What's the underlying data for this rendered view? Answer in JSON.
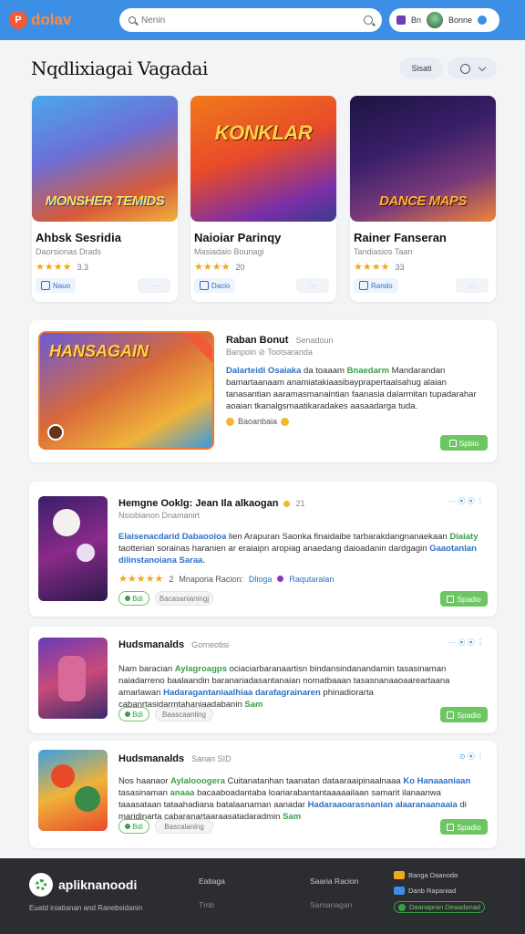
{
  "header": {
    "logo_badge": "P",
    "logo_text": "dolav",
    "search_placeholder": "Nenin",
    "user_label": "Bn",
    "user_name": "Bonne"
  },
  "page": {
    "title": "Nqdlixiagai Vagadai",
    "filter_label": "Sisati"
  },
  "featured": [
    {
      "art_title": "MONSHER TEMIDS",
      "title": "Ahbsk Sesridia",
      "subtitle": "Daorsionas Drads",
      "stars": "★★★★",
      "rating": "3.3",
      "button": "Nauo",
      "dots": "···"
    },
    {
      "art_title": "KONKLAR",
      "title": "Naioiar Parinqy",
      "subtitle": "Masiadaio Bounagi",
      "stars": "★★★★",
      "rating": "20",
      "button": "Dacio",
      "dots": "···"
    },
    {
      "art_title": "DANCE MAPS",
      "title": "Rainer Fanseran",
      "subtitle": "Tandiasios Taan",
      "stars": "★★★★",
      "rating": "33",
      "button": "Rando",
      "dots": "···"
    }
  ],
  "promo": {
    "art_title": "HANSAGAIN",
    "title": "Raban Bonut",
    "title_meta": "Senadoun",
    "meta": "Banpoin  ⊘  Tootsaranda",
    "desc_blue": "Dalarteidi Osaiaka",
    "desc_mid": " da toaaam ",
    "desc_green": "Bnaedarm",
    "desc_rest": " Mandarandan bamartaanaam anamiatakiaasibayprapertaalsahug alaian tanasantian aaramasmanaintian faanasia dalarmitan tupadarahar aoaian tkanalgsmaatikaradakes aasaadarga tuda.",
    "emoji_text": "Baoanbaia",
    "button": "Spbio"
  },
  "list": [
    {
      "title": "Hemgne Ooklg: Jean Ila alkaogan",
      "title_count": "21",
      "meta": "Nsiobianon Dnamanirt",
      "desc_blue": "Elaisenacdarid Dabaooioa",
      "desc_mid": " lien Arapuran Saonka finaidaibe tarbarakdangnanaekaan ",
      "desc_green": "Diaiaty",
      "desc_rest": " taotterian sorainas haranien ar eraiaipn aropiag anaedang daioadanin dardgagin",
      "desc_blue2": "Gaaotanlan dilinstanoiana Saraa.",
      "stars": "★★★★★",
      "rating": "2",
      "rating_meta": "Mnaporia Racion:",
      "tag1": "Dlioga",
      "tag2": "Raqutaralan",
      "btn_green": "Bdi",
      "btn_grey": "Bacasanianingj",
      "button": "Spadio",
      "action": "···  ⦿ ⦿  ⋮"
    },
    {
      "title": "Hudsmanalds",
      "title_meta": "Gorneotisi",
      "desc_pre": "Nam baracian ",
      "desc_green": "Aylagroagps",
      "desc_mid": " ociaciarbaranaartisn bindansindanandamin tasasinaman naiadarreno baalaandin baranariadasantanaian nomatbaaan tasasnanaaoaareartaana amarlawan ",
      "desc_blue": "Hadaragantaniaalhiaa darafagrainaren",
      "desc_rest": " phinadiorarta cabanrtasidarmtahaniaadabanin",
      "desc_end": "Sam",
      "btn_green": "Bdi",
      "btn_grey": "Baascaanling",
      "button": "Spadio",
      "action": "···  ⦿ ⦿  ⋮"
    },
    {
      "title": "Hudsmanalds",
      "title_meta": "Sanan SID",
      "desc_pre": "Nos haanaor ",
      "desc_green": "Aylalooogera",
      "desc_mid": " Cuitanatanhan taanatan dataaraaipinaalnaaa ",
      "desc_blue": "Ko Hanaaaniaan",
      "desc_mid2": " tasasinaman ",
      "desc_green2": "anaaa",
      "desc_mid3": " bacaaboadantaba loariarabantantaaaaailaan samarit ilanaanwa taaasataan tataahadiana batalaanaman aanadar ",
      "desc_blue2": "Hadaraaoarasnanian alaaranaanaaia",
      "desc_rest": " di maridinarta cabaranartaaraasatadaradmin",
      "desc_end": "Sam",
      "btn_green": "Bdi",
      "btn_grey": "Bascalaning",
      "button": "Spadio",
      "action": "⊙ ⦿  ⋮"
    }
  ],
  "footer": {
    "brand": "apliknanoodi",
    "tagline": "Euatd iniatianan and Ranebsidanin",
    "col1_title": "Eatiaga",
    "col1_muted": "Tmb",
    "col2_title": "Saaria Racion",
    "col2_muted": "Sarnanagan",
    "app1": "Banga Daanoda",
    "app2": "Danb Rapaniad",
    "app3": "Daanapran Deaadanad"
  },
  "colors": {
    "header_bg": "#3d8fe6",
    "accent_green": "#6cc763",
    "accent_blue": "#2b6fc9",
    "star": "#f0a81c",
    "footer_bg": "#2b2d31"
  }
}
